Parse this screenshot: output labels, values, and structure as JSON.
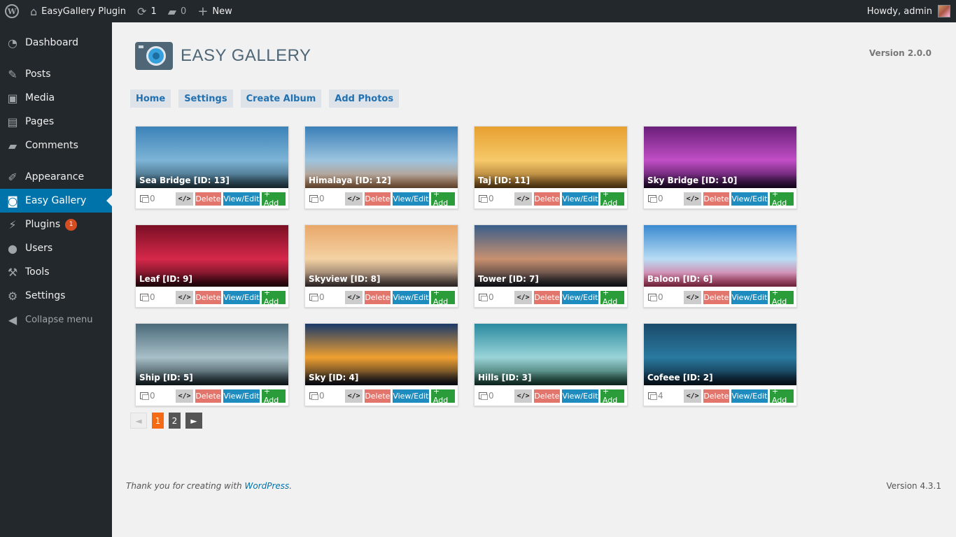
{
  "adminbar": {
    "site_name": "EasyGallery Plugin",
    "updates_count": "1",
    "comments_count": "0",
    "new_label": "New",
    "howdy": "Howdy, admin"
  },
  "sidebar": {
    "items": [
      {
        "label": "Dashboard",
        "icon": "dashboard-icon"
      },
      {
        "label": "Posts",
        "icon": "pin-icon"
      },
      {
        "label": "Media",
        "icon": "media-icon"
      },
      {
        "label": "Pages",
        "icon": "pages-icon"
      },
      {
        "label": "Comments",
        "icon": "comment-icon"
      },
      {
        "label": "Appearance",
        "icon": "brush-icon"
      },
      {
        "label": "Easy Gallery",
        "icon": "gallery-icon"
      },
      {
        "label": "Plugins",
        "icon": "plugin-icon",
        "badge": "1"
      },
      {
        "label": "Users",
        "icon": "user-icon"
      },
      {
        "label": "Tools",
        "icon": "wrench-icon"
      },
      {
        "label": "Settings",
        "icon": "settings-icon"
      }
    ],
    "collapse_label": "Collapse menu"
  },
  "page": {
    "title": "EASY GALLERY",
    "version": "Version 2.0.0",
    "tabs": [
      "Home",
      "Settings",
      "Create Album",
      "Add Photos"
    ]
  },
  "albums": [
    {
      "caption": "Sea Bridge [ID: 13]",
      "count": "0",
      "palette": [
        "#3b82b8",
        "#7db4d6",
        "#2b4a5a"
      ]
    },
    {
      "caption": "Himalaya [ID: 12]",
      "count": "0",
      "palette": [
        "#3a7fb8",
        "#9cc4df",
        "#c98a5a"
      ]
    },
    {
      "caption": "Taj [ID: 11]",
      "count": "0",
      "palette": [
        "#e7a030",
        "#f6c96a",
        "#8a5a20"
      ]
    },
    {
      "caption": "Sky Bridge [ID: 10]",
      "count": "0",
      "palette": [
        "#6a1f7a",
        "#c14ec5",
        "#2a0a3a"
      ]
    },
    {
      "caption": "Leaf [ID: 9]",
      "count": "0",
      "palette": [
        "#7a0f24",
        "#d6284a",
        "#3a0812"
      ]
    },
    {
      "caption": "Skyview [ID: 8]",
      "count": "0",
      "palette": [
        "#e9a86a",
        "#f4d2a4",
        "#5a4a4a"
      ]
    },
    {
      "caption": "Tower [ID: 7]",
      "count": "0",
      "palette": [
        "#3a5e8a",
        "#c89070",
        "#1a1f2a"
      ]
    },
    {
      "caption": "Baloon [ID: 6]",
      "count": "0",
      "palette": [
        "#3a8ad0",
        "#b8dcf4",
        "#e84a7a"
      ]
    },
    {
      "caption": "Ship [ID: 5]",
      "count": "0",
      "palette": [
        "#4a6a7a",
        "#a8c0c8",
        "#1a2a30"
      ]
    },
    {
      "caption": "Sky [ID: 4]",
      "count": "0",
      "palette": [
        "#1a3a6a",
        "#f0a030",
        "#0a1020"
      ]
    },
    {
      "caption": "Hills [ID: 3]",
      "count": "0",
      "palette": [
        "#2a8aa0",
        "#9ad4d8",
        "#1a4a3a"
      ]
    },
    {
      "caption": "Cofeee [ID: 2]",
      "count": "4",
      "palette": [
        "#1a4a6a",
        "#2a7aa0",
        "#0a1a2a"
      ]
    }
  ],
  "buttons": {
    "code": "</>",
    "delete": "Delete",
    "view_edit": "View/Edit",
    "add": "+ Add"
  },
  "pager": {
    "prev": "◄",
    "pages": [
      "1",
      "2"
    ],
    "current": "1",
    "next": "►"
  },
  "footer": {
    "thanks_prefix": "Thank you for creating with ",
    "wp_link": "WordPress",
    "thanks_suffix": ".",
    "version": "Version 4.3.1"
  }
}
